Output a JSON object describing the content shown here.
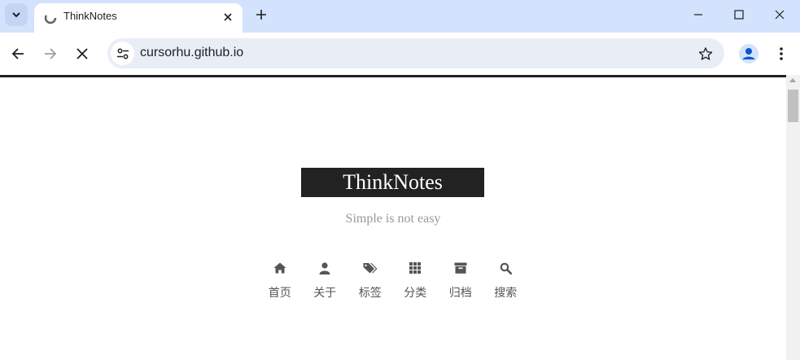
{
  "browser": {
    "tab": {
      "title": "ThinkNotes"
    },
    "address_bar": {
      "url": "cursorhu.github.io"
    }
  },
  "site": {
    "brand_title": "ThinkNotes",
    "subtitle": "Simple is not easy",
    "menu": [
      {
        "label": "首页",
        "icon": "home-icon"
      },
      {
        "label": "关于",
        "icon": "user-icon"
      },
      {
        "label": "标签",
        "icon": "tags-icon"
      },
      {
        "label": "分类",
        "icon": "th-icon"
      },
      {
        "label": "归档",
        "icon": "archive-icon"
      },
      {
        "label": "搜索",
        "icon": "search-icon"
      }
    ]
  },
  "colors": {
    "tabstrip": "#d3e3fd",
    "brand_bg": "#222222",
    "subtitle": "#999999",
    "menu_text": "#555555"
  }
}
